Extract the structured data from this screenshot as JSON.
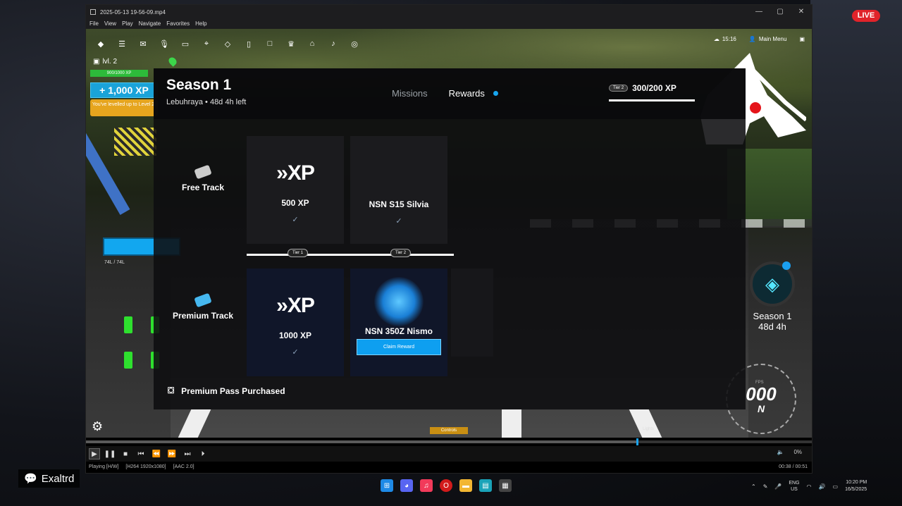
{
  "live_badge": "LIVE",
  "stream_name": "Exaltrd",
  "player": {
    "title": "2025-05-13 19-56-09.mp4",
    "menu": [
      "File",
      "View",
      "Play",
      "Navigate",
      "Favorites",
      "Help"
    ],
    "status": [
      "Playing [H/W]",
      "[H264 1920x1080]",
      "[AAC 2.0]"
    ],
    "time": "00:38 / 00:51",
    "volume": "0%",
    "progress_fraction": 0.76
  },
  "hud": {
    "clock": "15:16",
    "main_menu": "Main Menu",
    "level": "lvl. 2",
    "xp_bar": "900/1000 XP",
    "xp_gain": "+ 1,000 XP",
    "level_up": "You've levelled up to Level 2!",
    "fuel": "74L / 74L",
    "controls_tag": "Controls",
    "lights_tag": "Lights",
    "season_badge_title": "Season 1",
    "season_badge_time": "48d 4h",
    "speed": "000",
    "gear": "N",
    "fps_label": "FPS"
  },
  "panel": {
    "title": "Season 1",
    "subtitle": "Lebuhraya  •  48d 4h left",
    "tabs": {
      "missions": "Missions",
      "rewards": "Rewards"
    },
    "tier_pill": "Tier 2",
    "tier_xp": "300/200 XP",
    "free_track": "Free Track",
    "premium_track": "Premium Track",
    "xp_logo": "»XP",
    "check": "✓",
    "free_cards": [
      {
        "name": "500 XP"
      },
      {
        "name": "NSN S15 Silvia"
      }
    ],
    "premium_cards": [
      {
        "name": "1000 XP"
      },
      {
        "name": "NSN 350Z Nismo",
        "button": "Claim Reward"
      }
    ],
    "tiers": [
      "Tier 1",
      "Tier 2"
    ],
    "purchased": "Premium Pass Purchased"
  },
  "taskbar": {
    "lang1": "ENG",
    "lang2": "US",
    "time": "10:20 PM",
    "date": "16/5/2025"
  }
}
